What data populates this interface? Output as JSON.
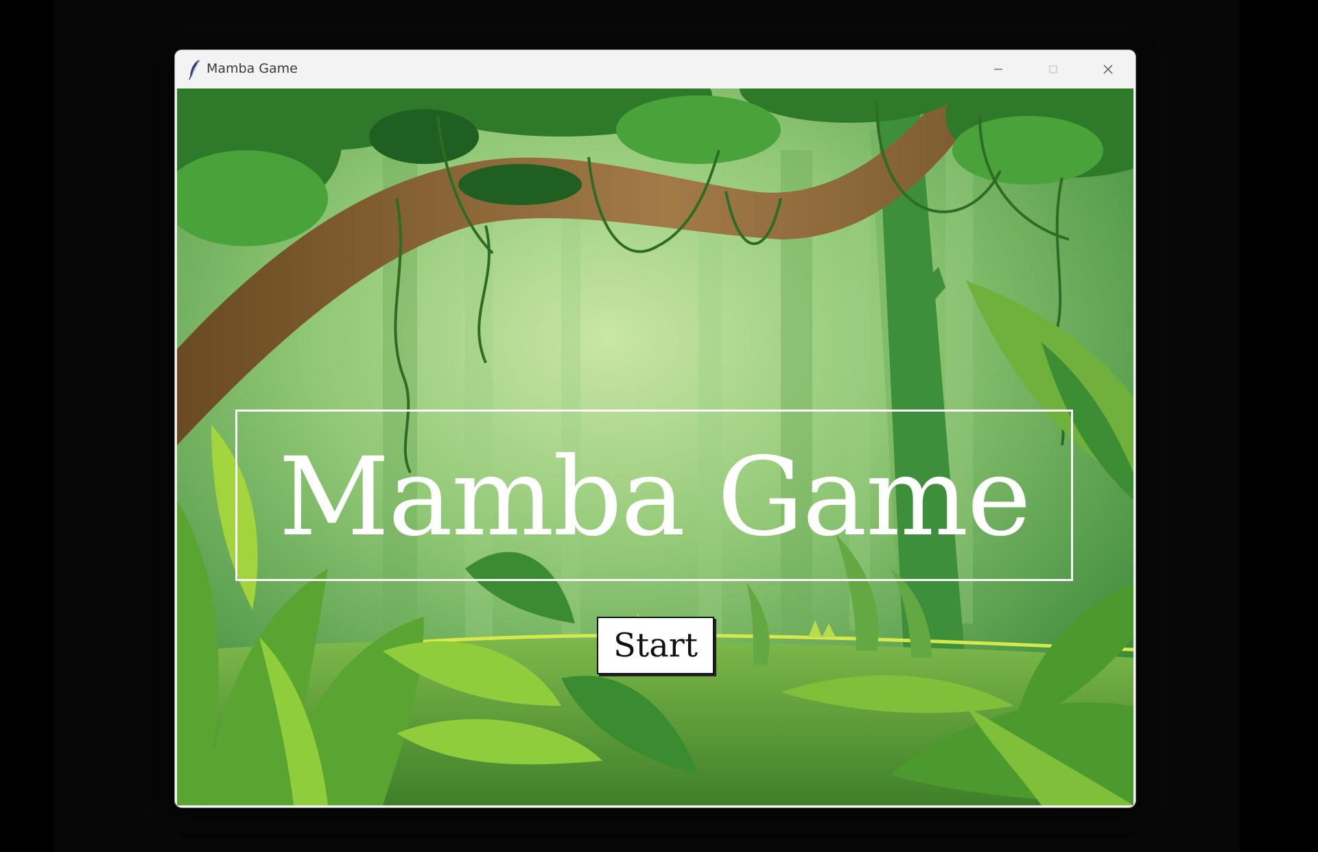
{
  "window": {
    "title": "Mamba Game",
    "app_icon": "feather-icon",
    "controls": [
      "minimize-icon",
      "maximize-icon",
      "close-icon"
    ]
  },
  "menu": {
    "game_title": "Mamba Game",
    "start_label": "Start"
  },
  "theme": {
    "background_scene": "jungle",
    "title_color": "#ffffff",
    "button_bg": "#ffffff",
    "button_text": "#111111"
  }
}
